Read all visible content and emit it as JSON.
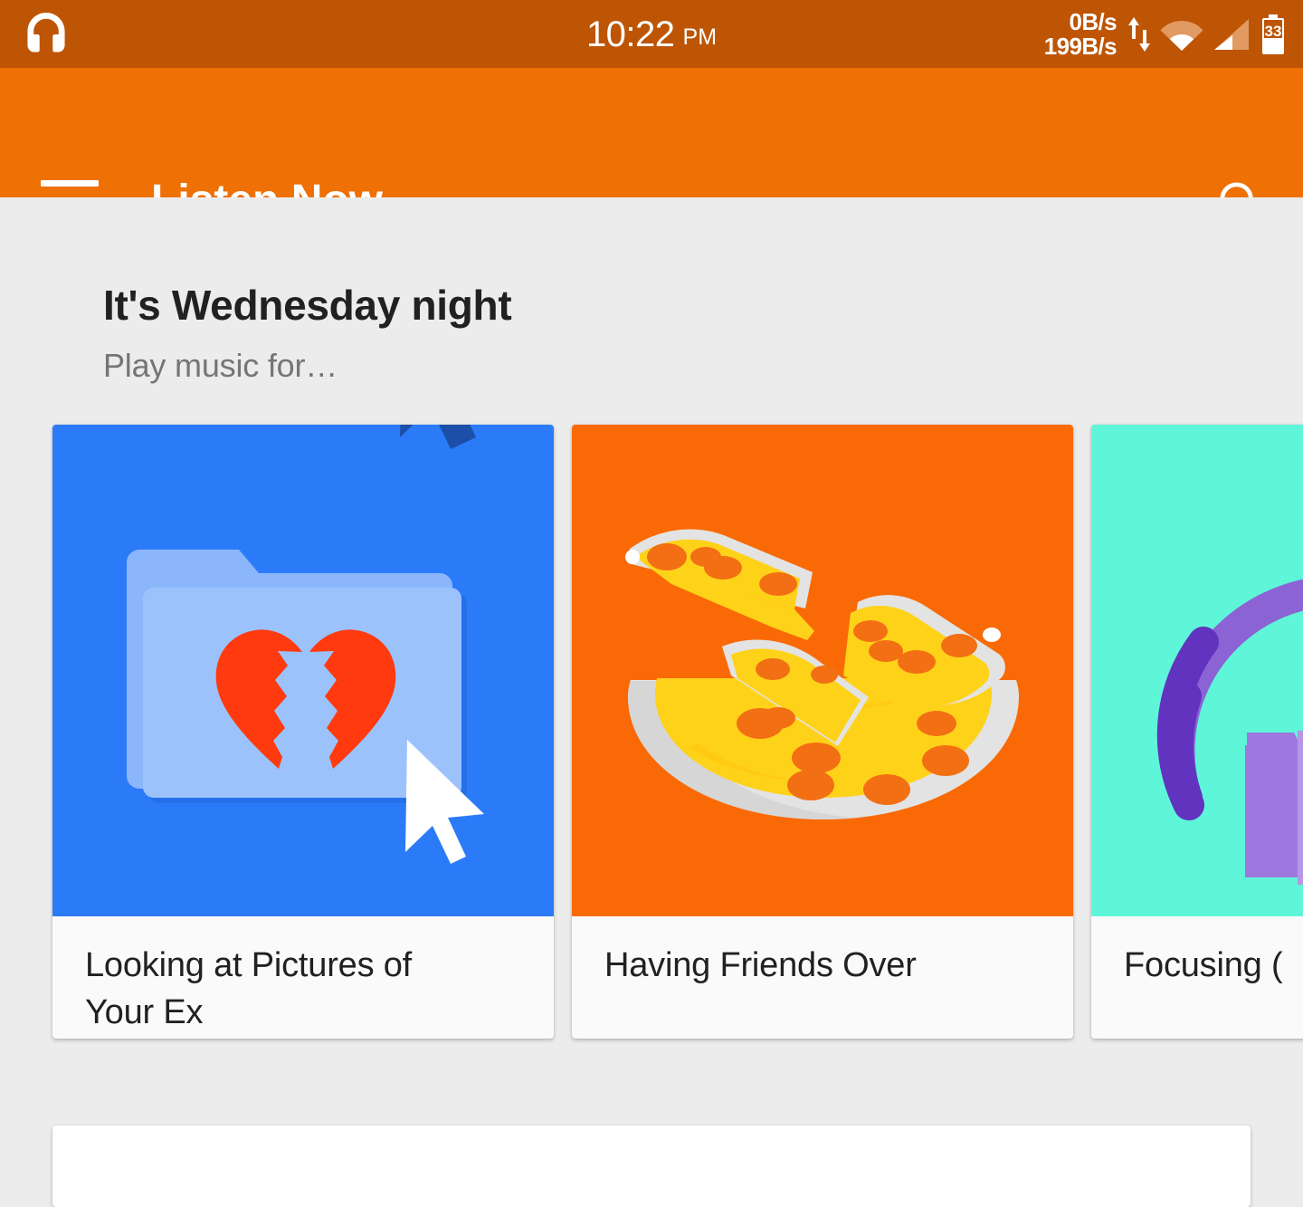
{
  "status_bar": {
    "background_color": "#BD5504",
    "notification_icon": "headphones-icon",
    "time": "10:22",
    "am_pm": "PM",
    "network_upload_rate": "0B/s",
    "network_download_rate": "199B/s",
    "icons": [
      "sync-arrows-icon",
      "wifi-icon",
      "cell-signal-icon",
      "battery-icon"
    ],
    "battery_level": "33"
  },
  "toolbar": {
    "background_color": "#EF7004",
    "menu_icon": "hamburger-menu-icon",
    "title": "Listen Now",
    "search_icon": "search-icon"
  },
  "main": {
    "background_color": "#ECECEC",
    "section_title": "It's Wednesday night",
    "section_subtitle": "Play music for…",
    "cards": [
      {
        "label": "Looking at Pictures of\nYour Ex",
        "art_name": "broken-heart-folder-art",
        "art_background_color": "#2B7BF8",
        "accent_color": "#FF3A0F"
      },
      {
        "label": "Having Friends Over",
        "art_name": "pizza-slices-art",
        "art_background_color": "#F96A06",
        "accent_color": "#FFD21A"
      },
      {
        "label": "Focusing (",
        "art_name": "headphones-scissors-art",
        "art_background_color": "#5FF5D8",
        "accent_color": "#7C4DC8"
      }
    ]
  }
}
